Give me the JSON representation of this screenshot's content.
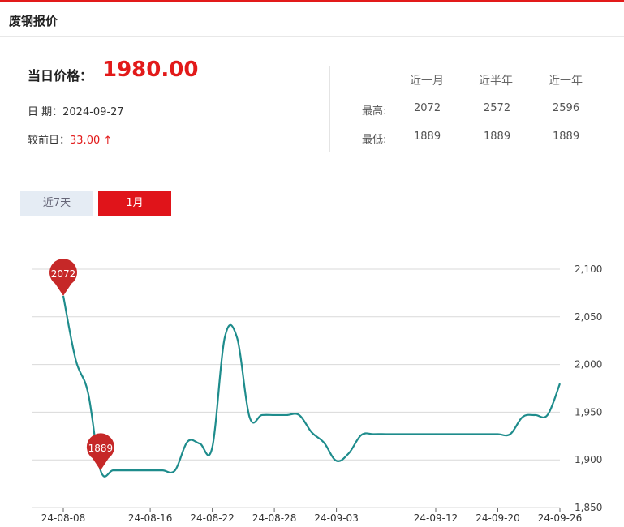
{
  "header": {
    "title": "废钢报价"
  },
  "summary": {
    "price_label": "当日价格：",
    "price_value": "1980.00",
    "date_label": "日 期：",
    "date_value": "2024-09-27",
    "change_label": "较前日：",
    "change_value": "33.00 ↑"
  },
  "stats": {
    "columns": [
      "近一月",
      "近半年",
      "近一年"
    ],
    "rows": [
      {
        "label": "最高:",
        "values": [
          "2072",
          "2572",
          "2596"
        ]
      },
      {
        "label": "最低:",
        "values": [
          "1889",
          "1889",
          "1889"
        ]
      }
    ]
  },
  "tabs": [
    {
      "label": "近7天",
      "active": false
    },
    {
      "label": "1月",
      "active": true
    }
  ],
  "colors": {
    "accent": "#e21a1a",
    "line": "#1e8c8c",
    "marker": "#c62828"
  },
  "chart_data": {
    "type": "line",
    "x": [
      "24-08-08",
      "24-08-09",
      "24-08-10",
      "24-08-12",
      "24-08-13",
      "24-08-14",
      "24-08-15",
      "24-08-16",
      "24-08-17",
      "24-08-19",
      "24-08-20",
      "24-08-21",
      "24-08-22",
      "24-08-23",
      "24-08-24",
      "24-08-26",
      "24-08-27",
      "24-08-28",
      "24-08-29",
      "24-08-30",
      "24-08-31",
      "24-09-02",
      "24-09-03",
      "24-09-04",
      "24-09-05",
      "24-09-06",
      "24-09-07",
      "24-09-09",
      "24-09-10",
      "24-09-11",
      "24-09-12",
      "24-09-13",
      "24-09-14",
      "24-09-18",
      "24-09-19",
      "24-09-20",
      "24-09-21",
      "24-09-23",
      "24-09-24",
      "24-09-25",
      "24-09-26",
      "24-09-27"
    ],
    "values": [
      2072,
      2005,
      1970,
      1889,
      1889,
      1889,
      1889,
      1889,
      1889,
      1889,
      1919,
      1917,
      1913,
      2028,
      2028,
      1945,
      1947,
      1947,
      1947,
      1947,
      1929,
      1918,
      1899,
      1907,
      1926,
      1927,
      1927,
      1927,
      1927,
      1927,
      1927,
      1927,
      1927,
      1927,
      1927,
      1927,
      1927,
      1945,
      1947,
      1947,
      1980
    ],
    "xticks": [
      "24-08-08",
      "24-08-16",
      "24-08-22",
      "24-08-28",
      "24-09-03",
      "24-09-12",
      "24-09-20",
      "24-09-26"
    ],
    "yticks": [
      "2,100",
      "2,050",
      "2,000",
      "1,950",
      "1,900",
      "1,850"
    ],
    "ylim": [
      1850,
      2100
    ],
    "markers": [
      {
        "label": "2072",
        "value": 2072
      },
      {
        "label": "1889",
        "value": 1889
      }
    ],
    "grid": true
  }
}
